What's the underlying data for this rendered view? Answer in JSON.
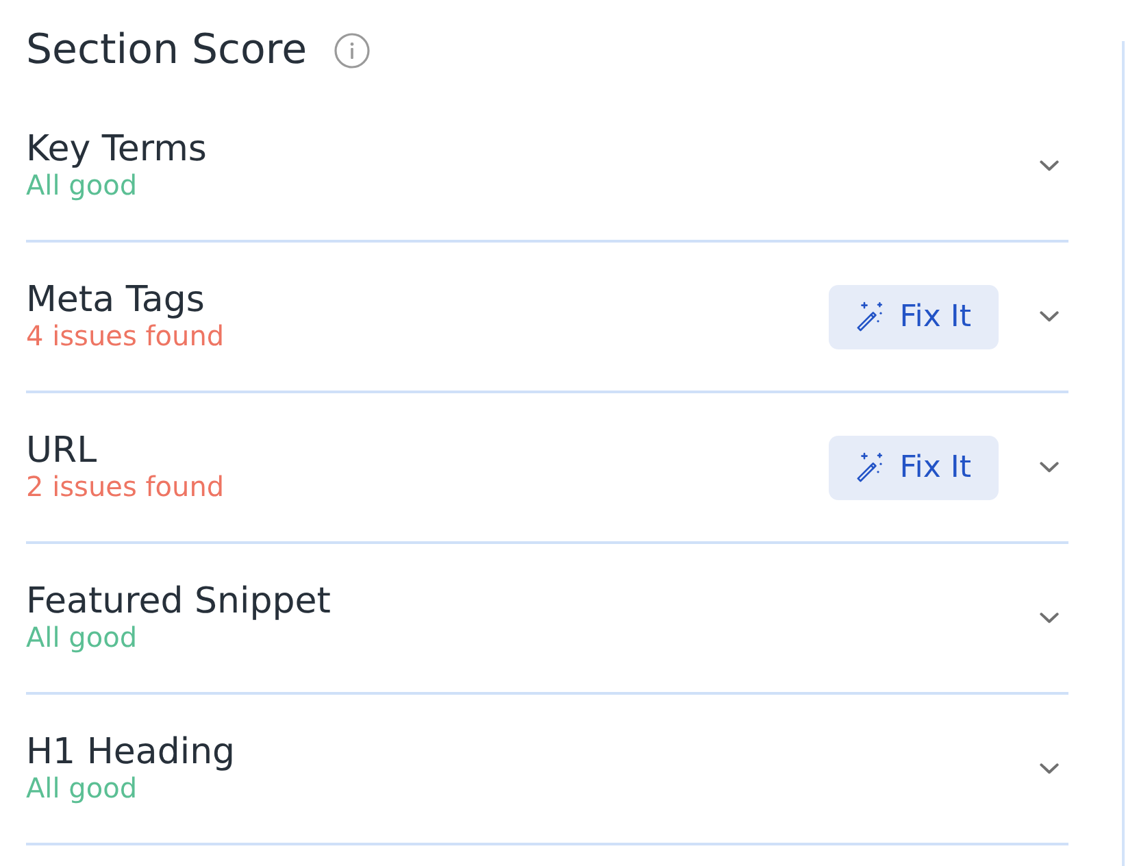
{
  "header": {
    "title": "Section Score"
  },
  "sections": [
    {
      "name": "Key Terms",
      "kind": "good",
      "summary": "All good",
      "expanded": false
    },
    {
      "name": "Meta Tags",
      "kind": "issues",
      "summary": "4 issues found",
      "fix_button": "Fix It",
      "expanded": false
    },
    {
      "name": "URL",
      "kind": "issues",
      "summary": "2 issues found",
      "fix_button": "Fix It",
      "expanded": false
    },
    {
      "name": "Featured Snippet",
      "kind": "good",
      "summary": "All good",
      "expanded": false
    },
    {
      "name": "H1 Heading",
      "kind": "good",
      "summary": "All good",
      "expanded": false
    }
  ]
}
